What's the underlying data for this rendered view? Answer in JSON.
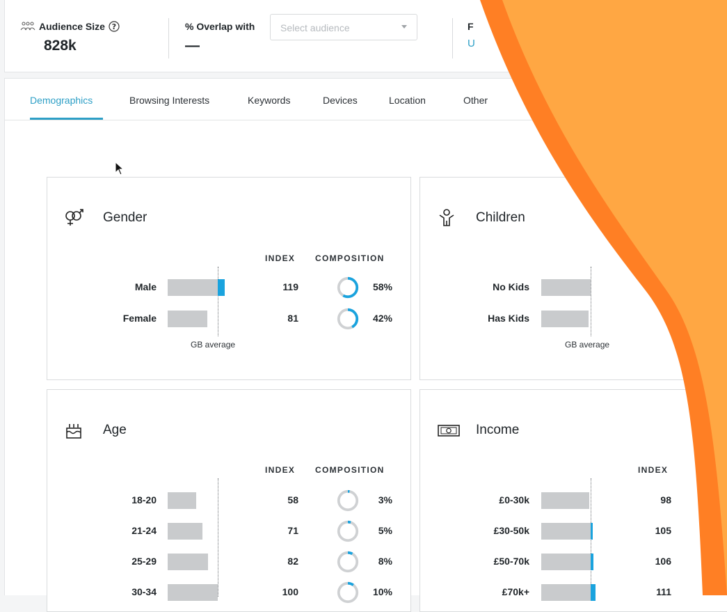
{
  "header": {
    "audience_size_label": "Audience Size",
    "audience_size_value": "828k",
    "overlap_label": "% Overlap with",
    "overlap_value": "—",
    "select_placeholder": "Select audience",
    "third_label_fragment": "F",
    "third_value_fragment": "U"
  },
  "tabs": [
    {
      "label": "Demographics",
      "active": true
    },
    {
      "label": "Browsing Interests"
    },
    {
      "label": "Keywords"
    },
    {
      "label": "Devices"
    },
    {
      "label": "Location"
    },
    {
      "label": "Other"
    }
  ],
  "columns": {
    "index": "INDEX",
    "composition": "COMPOSITION"
  },
  "average_label": "GB average",
  "cards": {
    "gender": {
      "title": "Gender",
      "rows": [
        {
          "label": "Male",
          "index": "119",
          "composition": "58%",
          "composition_value": 0.58
        },
        {
          "label": "Female",
          "index": "81",
          "composition": "42%",
          "composition_value": 0.42
        }
      ]
    },
    "children": {
      "title": "Children",
      "rows": [
        {
          "label": "No Kids"
        },
        {
          "label": "Has Kids"
        }
      ]
    },
    "age": {
      "title": "Age",
      "rows": [
        {
          "label": "18-20",
          "index": "58",
          "composition": "3%",
          "composition_value": 0.03
        },
        {
          "label": "21-24",
          "index": "71",
          "composition": "5%",
          "composition_value": 0.05
        },
        {
          "label": "25-29",
          "index": "82",
          "composition": "8%",
          "composition_value": 0.08
        },
        {
          "label": "30-34",
          "index": "100",
          "composition": "10%",
          "composition_value": 0.1
        }
      ]
    },
    "income": {
      "title": "Income",
      "rows": [
        {
          "label": "£0-30k",
          "index": "98"
        },
        {
          "label": "£30-50k",
          "index": "105"
        },
        {
          "label": "£50-70k",
          "index": "106"
        },
        {
          "label": "£70k+",
          "index": "111"
        }
      ]
    }
  },
  "colors": {
    "accent": "#2d9fc6",
    "bar": "#c9cbcd",
    "bar_highlight": "#1aa3de",
    "orange_dark": "#ff7f24",
    "orange_light": "#ffa743"
  }
}
